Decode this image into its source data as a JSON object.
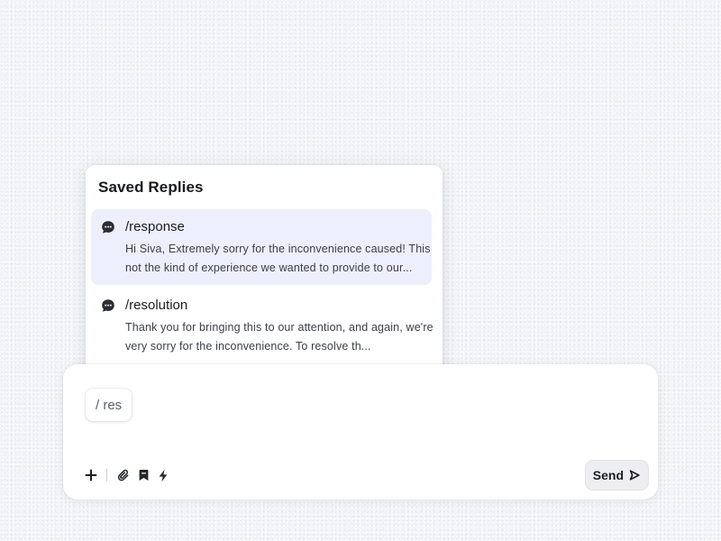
{
  "saved_replies": {
    "title": "Saved Replies",
    "items": [
      {
        "shortcut": "/response",
        "preview_line1": "Hi Siva, Extremely sorry for the inconvenience caused! This",
        "preview_line2": "not the kind of experience we wanted to provide to our...",
        "icon": "chat-bubble-icon",
        "highlighted": true
      },
      {
        "shortcut": "/resolution",
        "preview_line1": "Thank you for bringing this to our attention, and again, we're",
        "preview_line2": "very sorry for the inconvenience. To resolve th...",
        "icon": "chat-bubble-icon",
        "highlighted": false
      }
    ]
  },
  "composer": {
    "input_value": "/ res",
    "toolbar": [
      "plus-icon",
      "paperclip-icon",
      "bookmark-icon",
      "lightning-icon"
    ],
    "send_label": "Send",
    "send_icon": "send-arrow-icon"
  },
  "colors": {
    "highlight": "#eeeffc",
    "background": "#f3f4f7",
    "send_bg": "#eeeef1"
  }
}
